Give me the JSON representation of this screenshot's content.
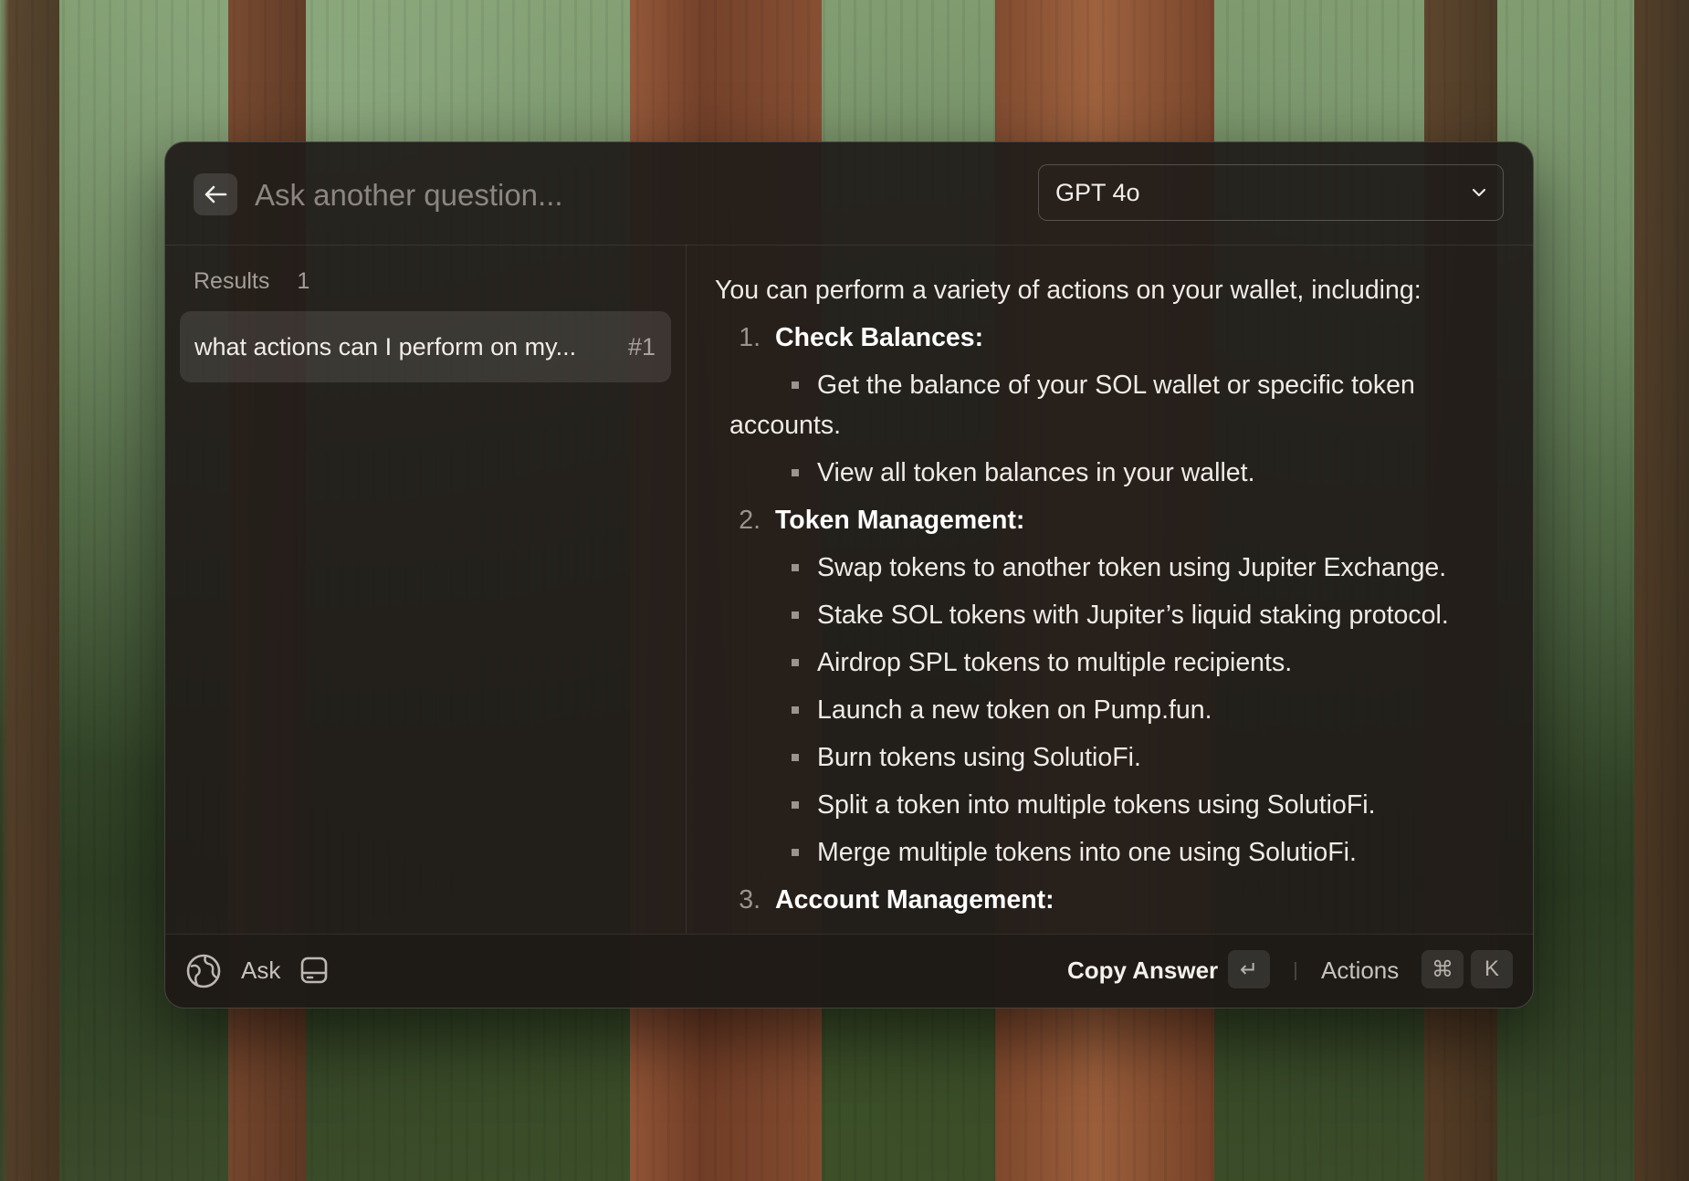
{
  "header": {
    "search_placeholder": "Ask another question...",
    "model_selected": "GPT 4o"
  },
  "sidebar": {
    "results_label": "Results",
    "results_count": "1",
    "items": [
      {
        "text": "what actions can I perform on my...",
        "index": "#1"
      }
    ]
  },
  "answer": {
    "intro": "You can perform a variety of actions on your wallet, including:",
    "sections": [
      {
        "num": "1.",
        "title": "Check Balances:",
        "items": [
          "Get the balance of your SOL wallet or specific token accounts.",
          "View all token balances in your wallet."
        ]
      },
      {
        "num": "2.",
        "title": "Token Management:",
        "items": [
          "Swap tokens to another token using Jupiter Exchange.",
          "Stake SOL tokens with Jupiter’s liquid staking protocol.",
          "Airdrop SPL tokens to multiple recipients.",
          "Launch a new token on Pump.fun.",
          "Burn tokens using SolutioFi.",
          "Split a token into multiple tokens using SolutioFi.",
          "Merge multiple tokens into one using SolutioFi."
        ]
      },
      {
        "num": "3.",
        "title": "Account Management:",
        "items": []
      }
    ]
  },
  "footer": {
    "ask_label": "Ask",
    "copy_answer_label": "Copy Answer",
    "copy_key": "↵",
    "actions_label": "Actions",
    "cmd_key": "⌘",
    "k_key": "K"
  }
}
